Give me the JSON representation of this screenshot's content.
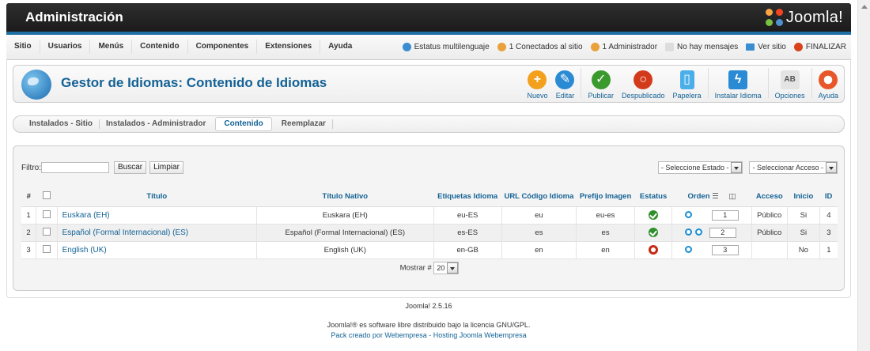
{
  "header": {
    "title": "Administración",
    "brand": "Joomla!"
  },
  "menu": [
    "Sitio",
    "Usuarios",
    "Menús",
    "Contenido",
    "Componentes",
    "Extensiones",
    "Ayuda"
  ],
  "status": {
    "multilang": "Estatus multilenguaje",
    "connected": "1 Conectados al sitio",
    "admin": "1 Administrador",
    "messages": "No hay mensajes",
    "view_site": "Ver sitio",
    "logout": "FINALIZAR"
  },
  "toolbar": {
    "title": "Gestor de Idiomas: Contenido de Idiomas",
    "buttons": {
      "new": "Nuevo",
      "edit": "Editar",
      "publish": "Publicar",
      "unpublish": "Despublicado",
      "trash": "Papelera",
      "install": "Instalar Idioma",
      "options": "Opciones",
      "help": "Ayuda"
    }
  },
  "subnav": [
    "Instalados - Sitio",
    "Instalados - Administrador",
    "Contenido",
    "Reemplazar"
  ],
  "filter": {
    "label": "Filtro:",
    "value": "",
    "search_label": "Buscar",
    "clear_label": "Limpiar",
    "state_select": "- Seleccione Estado -",
    "access_select": "- Seleccionar Acceso -"
  },
  "table": {
    "headers": {
      "num": "#",
      "title": "Título",
      "native": "Título Nativo",
      "tag": "Etiquetas Idioma",
      "url": "URL Código Idioma",
      "prefix": "Prefijo Imagen",
      "status": "Estatus",
      "order": "Orden",
      "access": "Acceso",
      "home": "Inicio",
      "id": "ID"
    },
    "rows": [
      {
        "num": "1",
        "title": "Euskara (EH)",
        "native": "Euskara (EH)",
        "tag": "eu-ES",
        "url": "eu",
        "prefix": "eu-es",
        "status": "published",
        "order": "1",
        "access": "Público",
        "home": "Si",
        "id": "4"
      },
      {
        "num": "2",
        "title": "Español (Formal Internacional) (ES)",
        "native": "Español (Formal Internacional) (ES)",
        "tag": "es-ES",
        "url": "es",
        "prefix": "es",
        "status": "published",
        "order": "2",
        "access": "Público",
        "home": "Si",
        "id": "3"
      },
      {
        "num": "3",
        "title": "English (UK)",
        "native": "English (UK)",
        "tag": "en-GB",
        "url": "en",
        "prefix": "en",
        "status": "unpublished",
        "order": "3",
        "access": "",
        "home": "No",
        "id": "1"
      }
    ],
    "show_label": "Mostrar #",
    "show_value": "20"
  },
  "footer": {
    "version": "Joomla! 2.5.16",
    "license": "Joomla!® es software libre distribuido bajo la licencia GNU/GPL.",
    "credits": "Pack creado por Webempresa - Hosting Joomla Webempresa"
  },
  "colors": {
    "accent": "#146295",
    "bar": "#1e6fa6",
    "ok": "#2f8f2b",
    "off": "#c52a13"
  }
}
